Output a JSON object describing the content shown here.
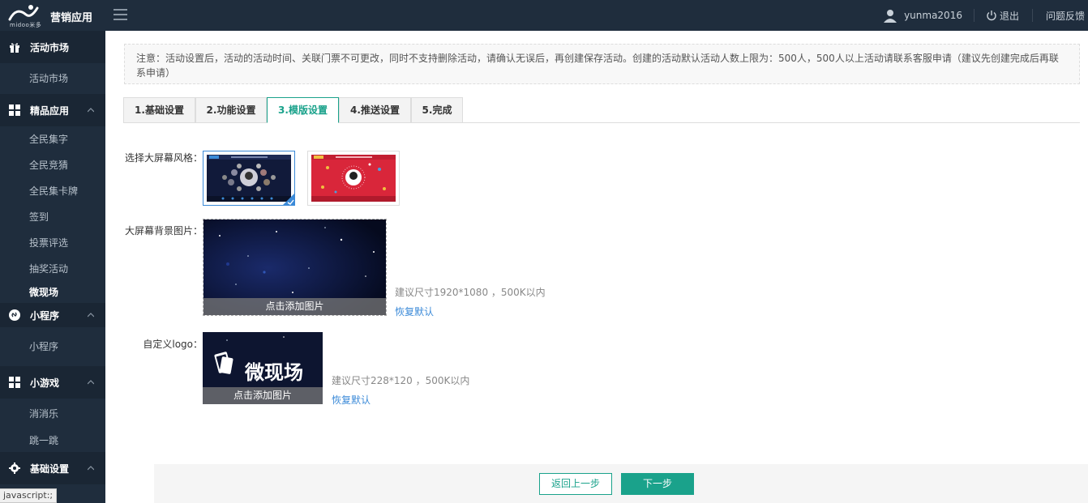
{
  "header": {
    "logo_text": "midoo米多",
    "app_title": "营销应用",
    "username": "yunma2016",
    "logout_label": "退出",
    "feedback_label": "问题反馈"
  },
  "sidebar": {
    "sections": [
      {
        "title": "活动市场",
        "icon": "gift-icon",
        "items": [
          "活动市场"
        ]
      },
      {
        "title": "精品应用",
        "icon": "apps-grid-icon",
        "items": [
          "全民集字",
          "全民竞猜",
          "全民集卡牌",
          "签到",
          "投票评选",
          "抽奖活动",
          "微现场"
        ]
      },
      {
        "title": "小程序",
        "icon": "miniprogram-icon",
        "items": [
          "小程序"
        ]
      },
      {
        "title": "小游戏",
        "icon": "apps-grid-icon",
        "items": [
          "消消乐",
          "跳一跳"
        ]
      },
      {
        "title": "基础设置",
        "icon": "gear-icon",
        "items": []
      }
    ],
    "active_item": "微现场"
  },
  "notice": "注意：活动设置后，活动的活动时间、关联门票不可更改，同时不支持删除活动，请确认无误后，再创建保存活动。创建的活动默认活动人数上限为：500人，500人以上活动请联系客服申请（建议先创建完成后再联系申请）",
  "tabs": [
    {
      "label": "1.基础设置",
      "active": false
    },
    {
      "label": "2.功能设置",
      "active": false
    },
    {
      "label": "3.模版设置",
      "active": true
    },
    {
      "label": "4.推送设置",
      "active": false
    },
    {
      "label": "5.完成",
      "active": false
    }
  ],
  "form": {
    "style_label": "选择大屏幕风格：",
    "bg_label": "大屏幕背景图片：",
    "bg_upload_label": "点击添加图片",
    "bg_hint": "建议尺寸1920*1080 ，500K以内",
    "bg_restore": "恢复默认",
    "logo_label": "自定义logo：",
    "logo_text": "微现场",
    "logo_upload_label": "点击添加图片",
    "logo_hint": "建议尺寸228*120 ，500K以内",
    "logo_restore": "恢复默认"
  },
  "footer": {
    "back_label": "返回上一步",
    "next_label": "下一步"
  },
  "status_tip": "javascript:;",
  "colors": {
    "topbar_bg": "#1f2d3d",
    "accent_green": "#1aa28b",
    "link_blue": "#3b8ad8"
  }
}
